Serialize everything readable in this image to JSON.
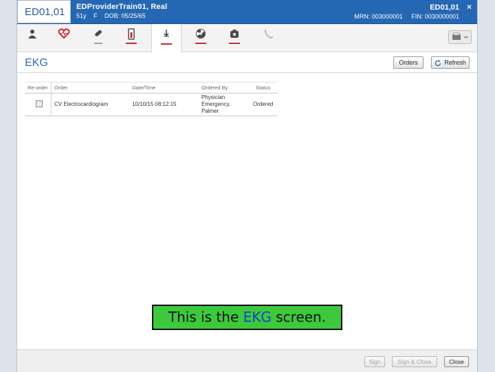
{
  "header": {
    "location": "ED01,01",
    "patient_name": "EDProviderTrain01, Real",
    "age": "51y",
    "sex": "F",
    "dob": "DOB: 05/25/65",
    "location_right": "ED01,01",
    "mrn": "MRN: 003000001",
    "fin": "FIN: 0030000001",
    "close_symbol": "×"
  },
  "toolbar": {
    "icons": [
      "user-icon",
      "heart-icon",
      "pill-icon",
      "lab-tube-icon",
      "arrow-down-icon",
      "radiation-icon",
      "camera-icon",
      "phone-icon"
    ],
    "active_icon": "arrow-down-icon",
    "accent": "#c8282c"
  },
  "section": {
    "title": "EKG",
    "orders_button": "Orders",
    "refresh_button": "Refresh"
  },
  "table": {
    "columns": [
      "Re-order",
      "Order",
      "Date/Time",
      "Ordered By",
      "Status"
    ],
    "rows": [
      {
        "order": "CV Electrocardiogram",
        "datetime": "10/10/15 08:12:15",
        "ordered_by": [
          "Physician",
          "Emergency,",
          "Palmer"
        ],
        "status": "Ordered"
      }
    ]
  },
  "caption": {
    "prefix": "This is the ",
    "highlight": "EKG",
    "suffix": " screen."
  },
  "footer": {
    "sign": "Sign",
    "sign_close": "Sign & Close",
    "close": "Close"
  },
  "colors": {
    "header_bg": "#2467b3",
    "title": "#2d6cb5",
    "caption_bg": "#3cc93c",
    "caption_highlight": "#1f3fd1"
  }
}
